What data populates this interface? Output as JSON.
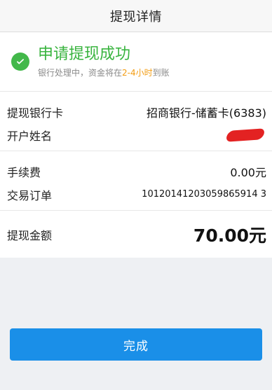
{
  "header": {
    "title": "提现详情"
  },
  "status": {
    "title": "申请提现成功",
    "subtitle_before": "银行处理中，资金将在",
    "subtitle_highlight": "2-4小时",
    "subtitle_after": "到账",
    "icon": "check-circle-icon",
    "color": "#39b43f"
  },
  "details": {
    "bank_label": "提现银行卡",
    "bank_value": "招商银行-储蓄卡(6383)",
    "name_label": "开户姓名",
    "name_value_redacted": true,
    "fee_label": "手续费",
    "fee_value": "0.00元",
    "order_label": "交易订单",
    "order_value": "10120141203059865914 3",
    "amount_label": "提现金额",
    "amount_value": "70.00元"
  },
  "button": {
    "done_label": "完成",
    "color": "#1a8fe8"
  }
}
